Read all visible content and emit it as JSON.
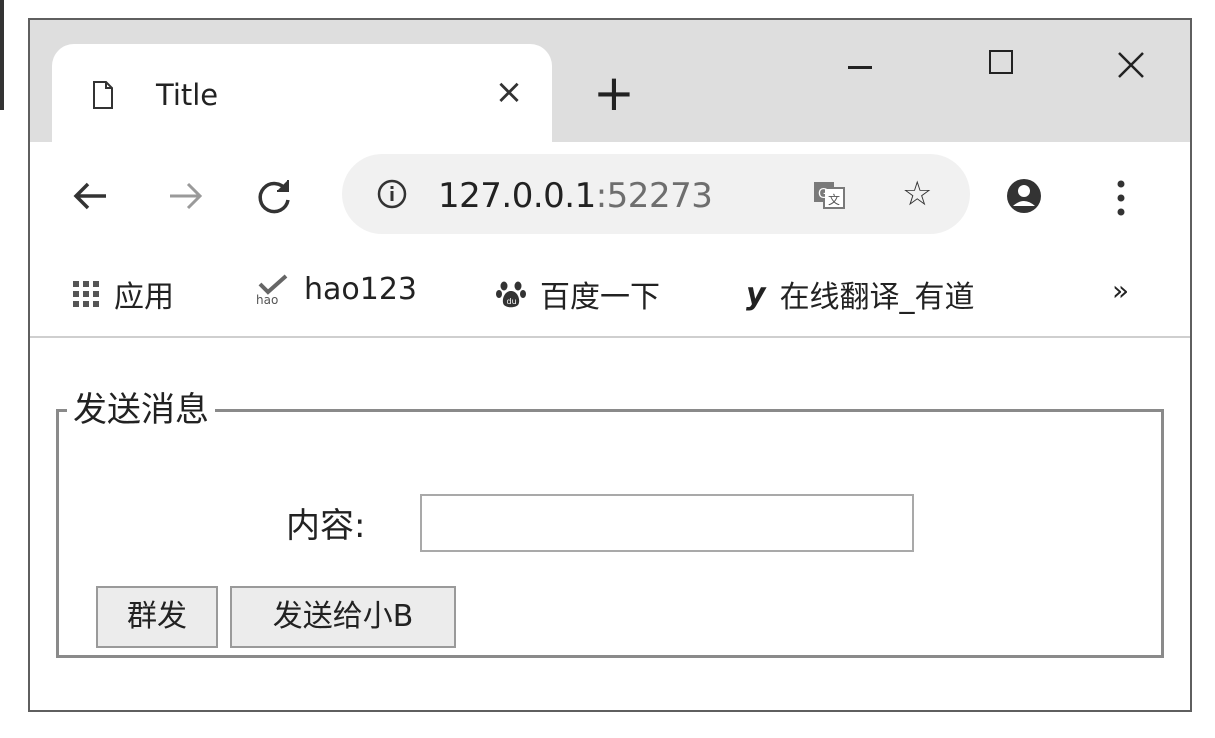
{
  "tab": {
    "title": "Title",
    "close": "×",
    "new_tab": "+"
  },
  "window_controls": {
    "minimize": "",
    "maximize": "",
    "close": "✕"
  },
  "address_bar": {
    "host": "127.0.0.1",
    "port": ":52273"
  },
  "icons": {
    "back": "back-arrow-icon",
    "forward": "forward-arrow-icon",
    "reload": "reload-icon",
    "info": "info-icon",
    "translate": "translate-icon",
    "star": "☆",
    "profile": "profile-icon",
    "menu": "more-menu-icon",
    "apps": "apps-grid-icon",
    "hao123": "hao123-icon",
    "baidu": "baidu-paw-icon",
    "youdao": "youdao-icon"
  },
  "bookmarks": {
    "apps": "应用",
    "hao123": "hao123",
    "baidu": "百度一下",
    "youdao_glyph": "y",
    "youdao": "在线翻译_有道",
    "more": "»"
  },
  "form": {
    "legend": "发送消息",
    "content_label": "内容:",
    "content_value": "",
    "broadcast_button": "群发",
    "send_to_b_button": "发送给小B"
  },
  "colors": {
    "tabstrip": "#dedede",
    "omnibox": "#f1f1f1",
    "button": "#ececec"
  }
}
